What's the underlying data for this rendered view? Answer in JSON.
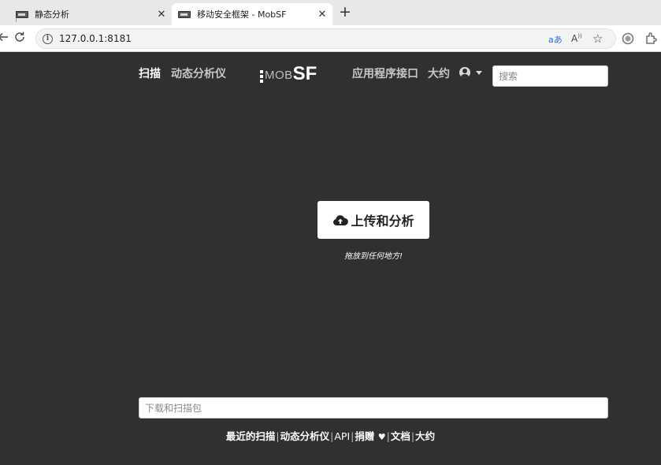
{
  "browser": {
    "tabs": [
      {
        "title": "静态分析",
        "active": false
      },
      {
        "title": "移动安全框架 - MobSF",
        "active": true
      }
    ],
    "new_tab_symbol": "+",
    "close_symbol": "✕",
    "url": "127.0.0.1:8181",
    "icons": [
      "back-arrow-icon",
      "reload-icon",
      "site-info-icon",
      "translate-icon",
      "read-aloud-icon",
      "favorite-star-icon",
      "browser-essentials-icon",
      "extensions-icon"
    ]
  },
  "navbar": {
    "links_left": [
      {
        "label": "扫描",
        "active": true
      },
      {
        "label": "动态分析仪",
        "active": false
      }
    ],
    "logo": {
      "mob": "MOB",
      "sf": "SF"
    },
    "links_right": [
      {
        "label": "应用程序接口"
      },
      {
        "label": "大约"
      }
    ],
    "search_placeholder": "搜索"
  },
  "main": {
    "upload_label": "上传和分析",
    "drop_hint": "拖放到任何地方!",
    "download_placeholder": "下载和扫描包"
  },
  "footer": {
    "links": [
      "最近的扫描",
      "动态分析仪",
      "API",
      "捐赠",
      "文档",
      "大约"
    ],
    "heart": "♥",
    "separator": "|"
  },
  "colors": {
    "page_background": "#303030",
    "text_light": "#ffffff",
    "nav_inactive": "#c8c8c8"
  }
}
